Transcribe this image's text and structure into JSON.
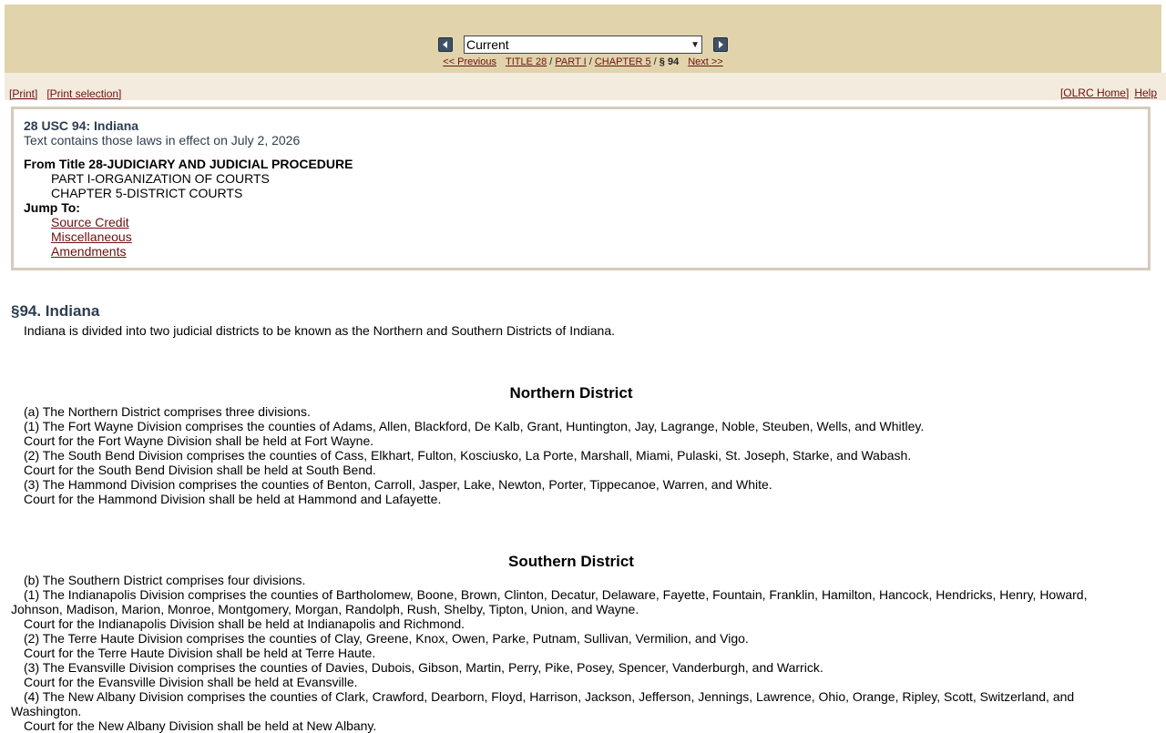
{
  "nav": {
    "prev_icon": "left-arrow-icon",
    "next_icon": "right-arrow-icon",
    "edition_selected": "Current",
    "previous_label": "<< Previous",
    "title_link": "TITLE 28",
    "part_link": "PART I",
    "chapter_link": "CHAPTER 5",
    "current_section": "§ 94",
    "next_label": "Next >>",
    "slash": "/"
  },
  "toolbar": {
    "print_label": "[Print]",
    "print_selection_label": "[Print selection]",
    "olrc_home_label": "[OLRC Home]",
    "help_label": "Help"
  },
  "info_box": {
    "doc_id": "28 USC 94: Indiana",
    "effective_note": "Text contains those laws in effect on July 2, 2026",
    "from_title": "From Title 28-JUDICIARY AND JUDICIAL PROCEDURE",
    "part": "PART I-ORGANIZATION OF COURTS",
    "chapter": "CHAPTER 5-DISTRICT COURTS",
    "jump_to_label": "Jump To:",
    "jump_links": [
      "Source Credit",
      "Miscellaneous",
      "Amendments"
    ]
  },
  "section": {
    "heading": "§94. Indiana",
    "intro": "Indiana is divided into two judicial districts to be known as the Northern and Southern Districts of Indiana.",
    "northern": {
      "heading": "Northern District",
      "lines": [
        "(a) The Northern District comprises three divisions.",
        "(1) The Fort Wayne Division comprises the counties of Adams, Allen, Blackford, De Kalb, Grant, Huntington, Jay, Lagrange, Noble, Steuben, Wells, and Whitley.",
        "Court for the Fort Wayne Division shall be held at Fort Wayne.",
        "(2) The South Bend Division comprises the counties of Cass, Elkhart, Fulton, Kosciusko, La Porte, Marshall, Miami, Pulaski, St. Joseph, Starke, and Wabash.",
        "Court for the South Bend Division shall be held at South Bend.",
        "(3) The Hammond Division comprises the counties of Benton, Carroll, Jasper, Lake, Newton, Porter, Tippecanoe, Warren, and White.",
        "Court for the Hammond Division shall be held at Hammond and Lafayette."
      ]
    },
    "southern": {
      "heading": "Southern District",
      "lines": [
        "(b) The Southern District comprises four divisions.",
        "(1) The Indianapolis Division comprises the counties of Bartholomew, Boone, Brown, Clinton, Decatur, Delaware, Fayette, Fountain, Franklin, Hamilton, Hancock, Hendricks, Henry, Howard, Johnson, Madison, Marion, Monroe, Montgomery, Morgan, Randolph, Rush, Shelby, Tipton, Union, and Wayne.",
        "Court for the Indianapolis Division shall be held at Indianapolis and Richmond.",
        "(2) The Terre Haute Division comprises the counties of Clay, Greene, Knox, Owen, Parke, Putnam, Sullivan, Vermilion, and Vigo.",
        "Court for the Terre Haute Division shall be held at Terre Haute.",
        "(3) The Evansville Division comprises the counties of Davies, Dubois, Gibson, Martin, Perry, Pike, Posey, Spencer, Vanderburgh, and Warrick.",
        "Court for the Evansville Division shall be held at Evansville.",
        "(4) The New Albany Division comprises the counties of Clark, Crawford, Dearborn, Floyd, Harrison, Jackson, Jefferson, Jennings, Lawrence, Ohio, Orange, Ripley, Scott, Switzerland, and Washington.",
        "Court for the New Albany Division shall be held at New Albany."
      ]
    }
  },
  "colors": {
    "nav_bg": "#e1d4ac",
    "toolbar_bg": "#f3ebdd",
    "link": "#6b1111",
    "heading": "#2c3e50",
    "box_border": "#d5cbbb"
  }
}
